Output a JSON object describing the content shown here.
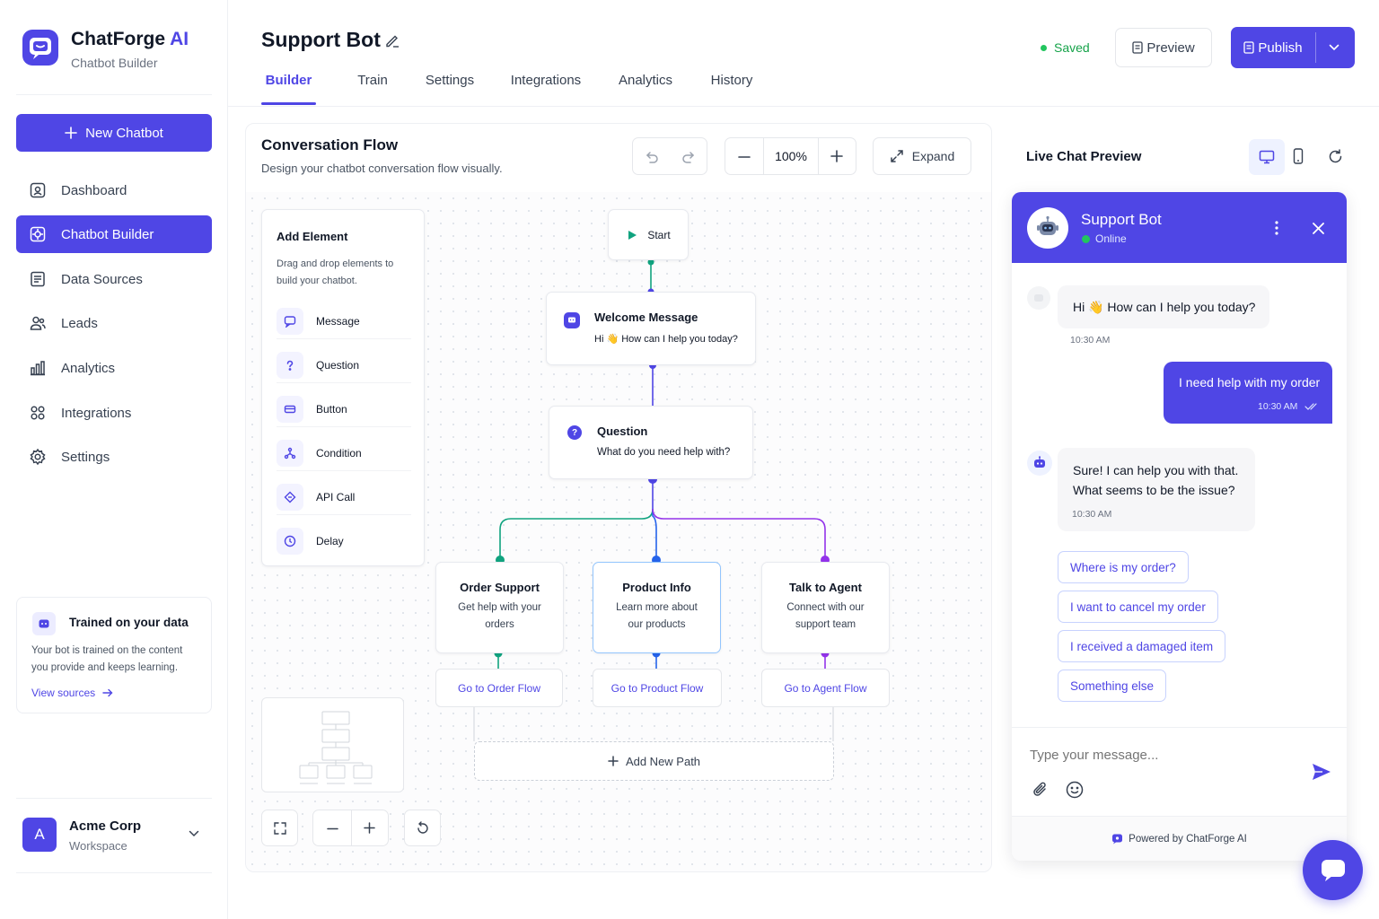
{
  "app": {
    "name": "ChatForge",
    "name_ai": "AI",
    "subtitle": "Chatbot Builder"
  },
  "sidebar": {
    "new_button": "New Chatbot",
    "items": [
      {
        "label": "Dashboard",
        "icon": "dashboard-icon"
      },
      {
        "label": "Chatbot Builder",
        "icon": "chatbot-icon",
        "active": true
      },
      {
        "label": "Data Sources",
        "icon": "data-sources-icon"
      },
      {
        "label": "Leads",
        "icon": "users-icon"
      },
      {
        "label": "Analytics",
        "icon": "bar-chart-icon"
      },
      {
        "label": "Integrations",
        "icon": "integrations-icon"
      },
      {
        "label": "Settings",
        "icon": "gear-icon"
      }
    ],
    "trained": {
      "title": "Trained on your data",
      "body": "Your bot is trained on the content you provide and keeps learning.",
      "link": "View sources"
    },
    "workspace": {
      "initial": "A",
      "name": "Acme Corp",
      "sub": "Workspace"
    }
  },
  "header": {
    "title": "Support Bot",
    "tabs": [
      "Builder",
      "Train",
      "Settings",
      "Integrations",
      "Analytics",
      "History"
    ],
    "active_tab": "Builder",
    "status": "Saved",
    "preview": "Preview",
    "publish": "Publish"
  },
  "flow": {
    "title": "Conversation Flow",
    "subtitle": "Design your chatbot conversation flow visually.",
    "zoom": "100%",
    "expand": "Expand",
    "add_element": {
      "title": "Add Element",
      "subtitle": "Drag and drop elements to build your chatbot.",
      "items": [
        "Message",
        "Question",
        "Button",
        "Condition",
        "API Call",
        "Delay"
      ]
    },
    "start": "Start",
    "welcome": {
      "title": "Welcome Message",
      "text": "Hi 👋 How can I help you today?"
    },
    "question": {
      "title": "Question",
      "text": "What do you need help with?"
    },
    "branches": [
      {
        "title": "Order Support",
        "text": "Get help with your orders",
        "action": "Go to Order Flow"
      },
      {
        "title": "Product Info",
        "text": "Learn more about our products",
        "action": "Go to Product Flow"
      },
      {
        "title": "Talk to Agent",
        "text": "Connect with our support team",
        "action": "Go to Agent Flow"
      }
    ],
    "add_path": "Add New Path"
  },
  "chat": {
    "panel_title": "Live Chat Preview",
    "bot_name": "Support Bot",
    "status": "Online",
    "messages": [
      {
        "from": "bot",
        "text": "Hi 👋 How can I help you today?",
        "time": "10:30 AM"
      },
      {
        "from": "user",
        "text": "I need help with my order",
        "time": "10:30 AM"
      },
      {
        "from": "bot",
        "line1": "Sure! I can help you with that.",
        "line2": "What seems to be the issue?",
        "time": "10:30 AM"
      }
    ],
    "quick_replies": [
      "Where is my order?",
      "I want to cancel my order",
      "I received a damaged item",
      "Something else"
    ],
    "input_placeholder": "Type your message...",
    "powered_by": "Powered by ChatForge AI"
  },
  "colors": {
    "accent": "#4f46e5",
    "green": "#16a34a",
    "teal": "#10a37f",
    "purple": "#9333ea",
    "blue": "#2563eb"
  }
}
